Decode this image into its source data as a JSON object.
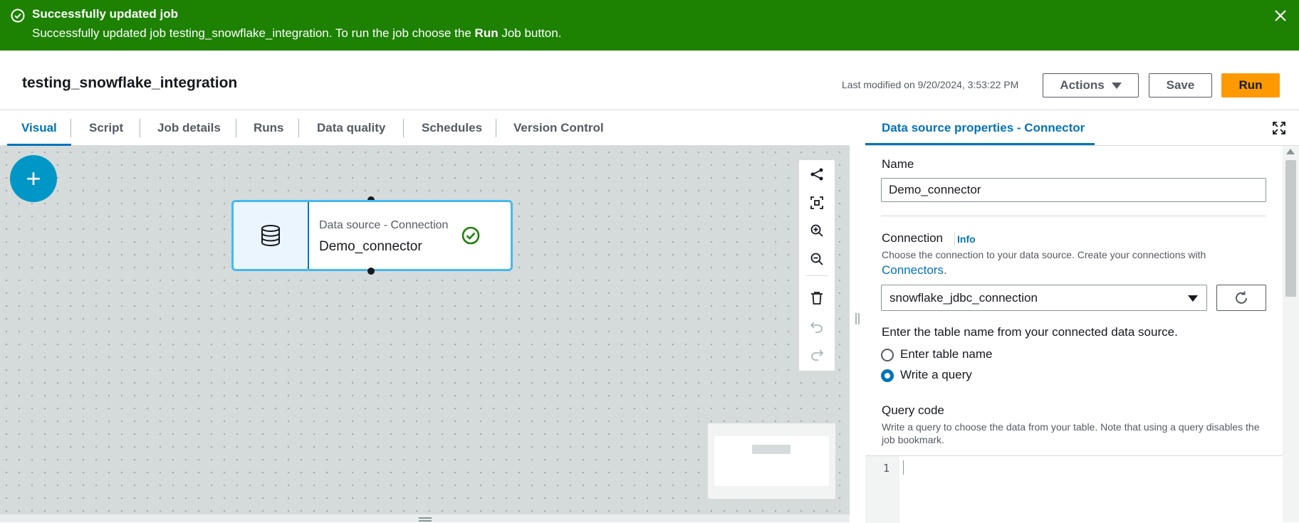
{
  "flash": {
    "title": "Successfully updated job",
    "message_prefix": "Successfully updated job testing_snowflake_integration. To run the job choose the ",
    "message_bold": "Run",
    "message_suffix": " Job button.",
    "color": "#1d8102"
  },
  "header": {
    "job_name": "testing_snowflake_integration",
    "last_modified": "Last modified on 9/20/2024, 3:53:22 PM",
    "actions_label": "Actions",
    "save_label": "Save",
    "run_label": "Run"
  },
  "tabs": [
    {
      "label": "Visual",
      "active": true
    },
    {
      "label": "Script"
    },
    {
      "label": "Job details"
    },
    {
      "label": "Runs"
    },
    {
      "label": "Data quality"
    },
    {
      "label": "Schedules"
    },
    {
      "label": "Version Control"
    }
  ],
  "canvas": {
    "add_label": "+",
    "node": {
      "kind": "Data source - Connection",
      "name": "Demo_connector",
      "icon": "database-icon",
      "status_icon": "check-circle-icon"
    },
    "toolbar_icons": [
      "layout-icon",
      "fit-view-icon",
      "zoom-in-icon",
      "zoom-out-icon",
      "delete-icon",
      "undo-icon",
      "redo-icon"
    ]
  },
  "panel": {
    "tab_label": "Data source properties - Connector",
    "name_label": "Name",
    "name_value": "Demo_connector",
    "connection_label": "Connection",
    "info_label": "Info",
    "connection_desc": "Choose the connection to your data source. Create your connections with",
    "connectors_link": "Connectors",
    "connectors_suffix": ".",
    "connection_value": "snowflake_jdbc_connection",
    "table_prompt": "Enter the table name from your connected data source.",
    "radio_table": "Enter table name",
    "radio_query": "Write a query",
    "selected_option": "Write a query",
    "query_label": "Query code",
    "query_desc": "Write a query to choose the data from your table. Note that using a query disables the job bookmark.",
    "line_number": "1"
  },
  "colors": {
    "accent": "#0073bb",
    "run_button": "#ff9900",
    "success": "#1d8102",
    "node_border": "#44b9f0"
  }
}
